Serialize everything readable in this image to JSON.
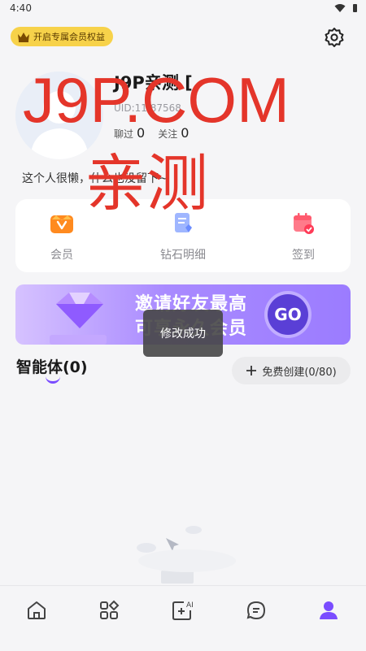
{
  "status": {
    "time": "4:40"
  },
  "header": {
    "vip_label": "开启专属会员权益"
  },
  "profile": {
    "nickname": "J9P亲测 [",
    "uid": "UID:11 87568",
    "chat_label": "聊过",
    "chat_count": "0",
    "follow_label": "关注",
    "follow_count": "0",
    "bio": "这个人很懒，什么也没留下~"
  },
  "watermark": {
    "line1": "J9P.COM",
    "line2": "亲测"
  },
  "quick_actions": [
    {
      "label": "会员",
      "icon": "vip-icon"
    },
    {
      "label": "钻石明细",
      "icon": "diamond-detail-icon"
    },
    {
      "label": "签到",
      "icon": "checkin-icon"
    }
  ],
  "banner": {
    "line1": "邀请好友最高",
    "line2": "可享永久会员",
    "cta": "GO"
  },
  "toast": {
    "text": "修改成功"
  },
  "agents": {
    "title": "智能体(0)",
    "create_label": "免费创建(0/80)"
  },
  "tabbar": {
    "items": [
      {
        "icon": "home-icon"
      },
      {
        "icon": "apps-icon"
      },
      {
        "icon": "ai-create-icon"
      },
      {
        "icon": "chat-icon"
      },
      {
        "icon": "profile-icon",
        "active": true
      }
    ]
  },
  "colors": {
    "accent": "#7a4cff",
    "vip": "#f7d24a",
    "watermark": "#e4352a"
  }
}
